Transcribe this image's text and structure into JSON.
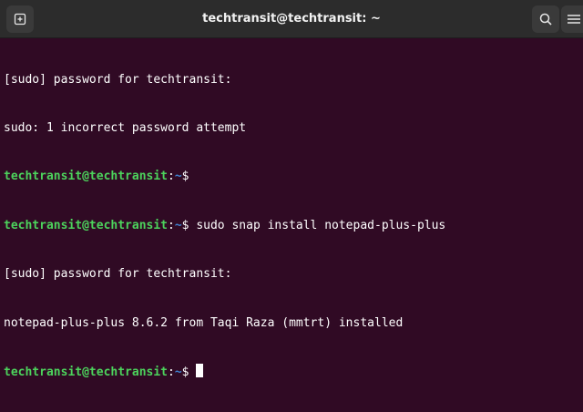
{
  "window": {
    "title": "techtransit@techtransit: ~"
  },
  "toolbar": {
    "new_tab_icon": "new-tab-icon",
    "search_icon": "search-icon",
    "menu_icon": "hamburger-menu-icon"
  },
  "terminal": {
    "colors": {
      "background": "#300a24",
      "user": "#4cd35c",
      "path": "#3f82d0",
      "text": "#ffffff"
    },
    "lines": [
      {
        "text": "[sudo] password for techtransit:"
      },
      {
        "text": "sudo: 1 incorrect password attempt"
      },
      {
        "user": "techtransit@techtransit",
        "sep": ":",
        "path": "~",
        "prompt": "$",
        "cmd": ""
      },
      {
        "user": "techtransit@techtransit",
        "sep": ":",
        "path": "~",
        "prompt": "$",
        "cmd": " sudo snap install notepad-plus-plus"
      },
      {
        "text": "[sudo] password for techtransit:"
      },
      {
        "text": "notepad-plus-plus 8.6.2 from Taqi Raza (mmtrt) installed"
      },
      {
        "user": "techtransit@techtransit",
        "sep": ":",
        "path": "~",
        "prompt": "$",
        "cmd": " "
      }
    ]
  }
}
